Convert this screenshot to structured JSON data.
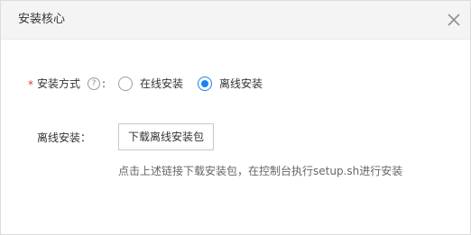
{
  "dialog": {
    "title": "安装核心",
    "close_icon": "close-icon"
  },
  "install_method": {
    "required_mark": "*",
    "label": "安装方式",
    "help_icon": "question-circle-icon",
    "help_glyph": "?",
    "colon": ":",
    "options": [
      {
        "label": "在线安装",
        "checked": false
      },
      {
        "label": "离线安装",
        "checked": true
      }
    ],
    "accent_color": "#1a82f0"
  },
  "offline_install": {
    "label": "离线安装：",
    "download_button": "下载离线安装包",
    "hint": "点击上述链接下载安装包，在控制台执行setup.sh进行安装"
  }
}
